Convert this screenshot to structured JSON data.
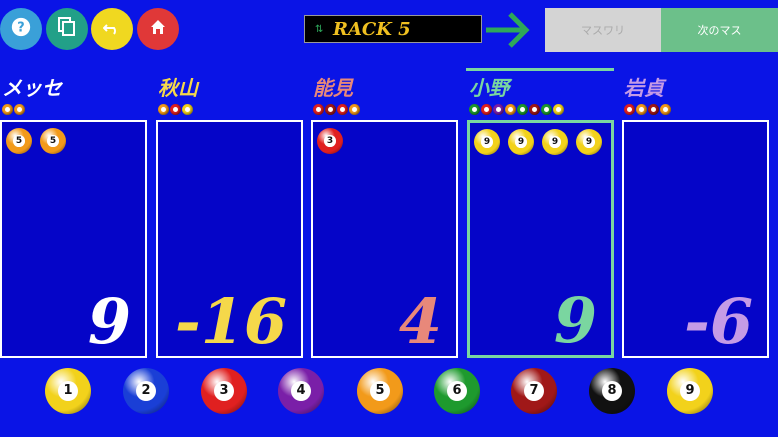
{
  "toolbar": {
    "help_icon": "question-icon",
    "copy_icon": "copy-icon",
    "undo_icon": "undo-icon",
    "home_icon": "home-icon"
  },
  "rack": {
    "label": "RACK 5",
    "sort_icon": "sort-arrows-icon"
  },
  "buttons": {
    "masuwari": "マスワリ",
    "next": "次のマス"
  },
  "colors": {
    "bg": "#0a14e6",
    "ball1": "#f2d21b",
    "ball2": "#1a3fd6",
    "ball3": "#e02020",
    "ball4": "#7a1fa8",
    "ball5": "#f29a1a",
    "ball6": "#1e9a2e",
    "ball7": "#a01818",
    "ball8": "#111111",
    "ball9": "#f2d21b",
    "active": "#7ad6a0"
  },
  "players": [
    {
      "name": "メッセ",
      "score": "9",
      "name_color": "#ffffff",
      "score_color": "#ffffff",
      "mini": [
        5,
        5
      ],
      "balls": [
        5,
        5
      ]
    },
    {
      "name": "秋山",
      "score": "-16",
      "name_color": "#f5d84a",
      "score_color": "#f5d84a",
      "mini": [
        5,
        3,
        9
      ],
      "balls": []
    },
    {
      "name": "能見",
      "score": "4",
      "name_color": "#e8887a",
      "score_color": "#e8887a",
      "mini": [
        3,
        7,
        3,
        5
      ],
      "balls": [
        3
      ]
    },
    {
      "name": "小野",
      "score": "9",
      "name_color": "#7ad6a0",
      "score_color": "#7ad6a0",
      "mini": [
        6,
        3,
        4,
        5,
        6,
        7,
        6,
        9
      ],
      "balls": [
        9,
        9,
        9,
        9
      ],
      "active": true
    },
    {
      "name": "岩貞",
      "score": "-6",
      "name_color": "#c59be6",
      "score_color": "#c59be6",
      "mini": [
        3,
        5,
        7,
        5
      ],
      "balls": []
    }
  ],
  "bottom_balls": [
    "1",
    "2",
    "3",
    "4",
    "5",
    "6",
    "7",
    "8",
    "9"
  ]
}
